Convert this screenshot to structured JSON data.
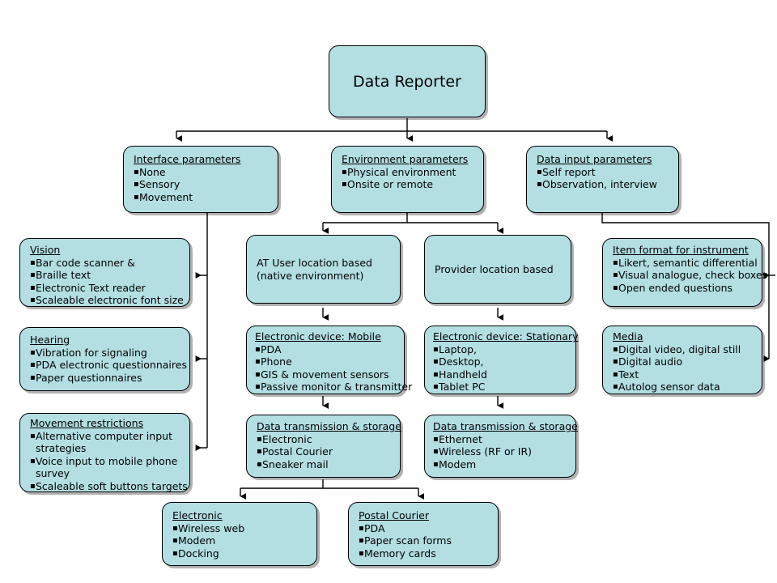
{
  "diagram": {
    "title": "Data Reporter",
    "type": "hierarchy-flowchart",
    "box_fill_color": "#b3dfe3",
    "box_border_color": "#000000",
    "connector_color": "#000000",
    "background_color": "#ffffff"
  },
  "nodes": {
    "root": {
      "title": "Data Reporter"
    },
    "interface_parameters": {
      "title": "Interface parameters",
      "items": [
        "None",
        "Sensory",
        "Movement"
      ]
    },
    "environment_parameters": {
      "title": "Environment parameters",
      "items": [
        "Physical environment",
        "Onsite or remote"
      ]
    },
    "data_input_parameters": {
      "title": "Data input parameters",
      "items": [
        "Self report",
        "Observation, interview"
      ]
    },
    "vision": {
      "title": "Vision",
      "items": [
        "Bar code scanner &",
        "Braille text",
        "Electronic Text reader",
        "Scaleable electronic font size"
      ]
    },
    "hearing": {
      "title": "Hearing",
      "items": [
        "Vibration for signaling",
        "PDA electronic questionnaires",
        "Paper questionnaires"
      ]
    },
    "movement_restrictions": {
      "title": "Movement restrictions",
      "items": [
        "Alternative computer input strategies",
        "Voice input to mobile phone survey",
        "Scaleable soft buttons targets"
      ]
    },
    "at_user_location": {
      "title": "AT User location based\n(native environment)"
    },
    "provider_location": {
      "title": "Provider location based"
    },
    "item_format": {
      "title": "Item format for instrument",
      "items": [
        "Likert, semantic differential",
        "Visual analogue, check boxes",
        "Open ended questions"
      ]
    },
    "device_mobile": {
      "title": "Electronic device: Mobile",
      "items": [
        "PDA",
        "Phone",
        "GIS & movement sensors",
        "Passive monitor & transmitter"
      ]
    },
    "device_stationary": {
      "title": "Electronic device: Stationary",
      "items": [
        "Laptop,",
        "Desktop,",
        "Handheld",
        "Tablet PC"
      ]
    },
    "media": {
      "title": "Media",
      "items": [
        "Digital video, digital still",
        "Digital audio",
        "Text",
        "Autolog sensor data"
      ]
    },
    "transmission_mobile": {
      "title": "Data transmission & storage",
      "items": [
        "Electronic",
        "Postal Courier",
        "Sneaker mail"
      ]
    },
    "transmission_stationary": {
      "title": "Data transmission & storage",
      "items": [
        "Ethernet",
        "Wireless (RF or IR)",
        "Modem"
      ]
    },
    "electronic": {
      "title": "Electronic",
      "items": [
        "Wireless web",
        "Modem",
        "Docking"
      ]
    },
    "postal_courier": {
      "title": "Postal Courier",
      "items": [
        "PDA",
        "Paper scan forms",
        "Memory cards"
      ]
    }
  }
}
